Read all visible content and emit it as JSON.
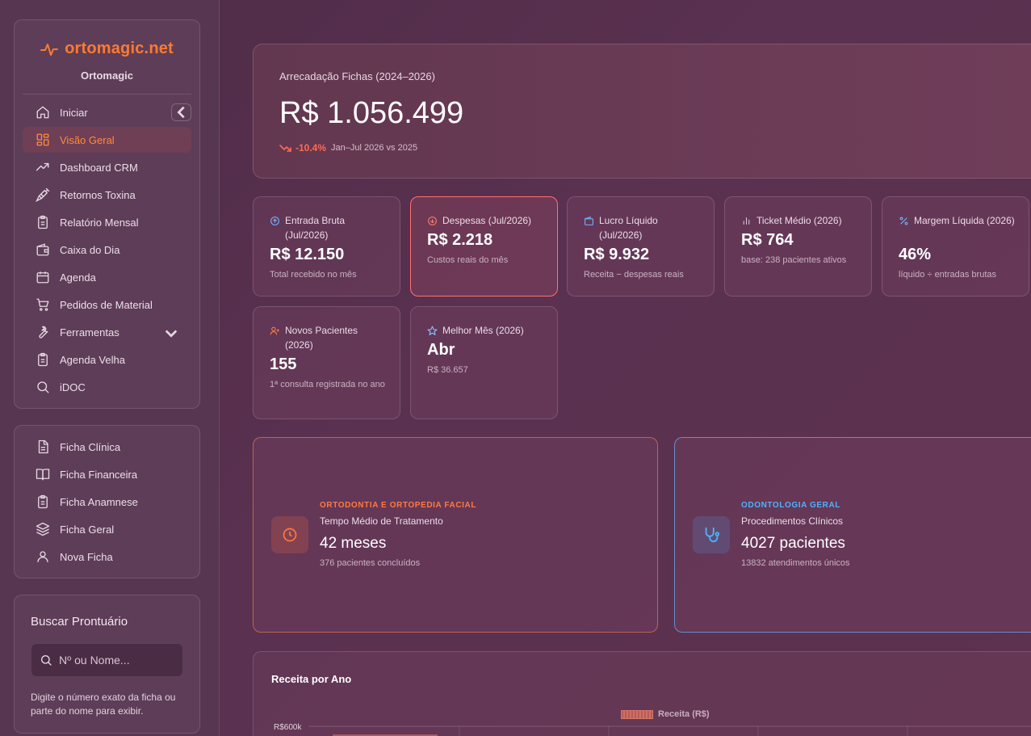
{
  "sidebar": {
    "brand_name": "ortomagic.net",
    "brand_sub": "Ortomagic",
    "items": [
      {
        "label": "Iniciar",
        "icon": "home-icon"
      },
      {
        "label": "Visão Geral",
        "icon": "grid-icon"
      },
      {
        "label": "Dashboard CRM",
        "icon": "trending-icon"
      },
      {
        "label": "Retornos Toxina",
        "icon": "syringe-icon"
      },
      {
        "label": "Relatório Mensal",
        "icon": "clipboard-icon"
      },
      {
        "label": "Caixa do Dia",
        "icon": "wallet-icon"
      },
      {
        "label": "Agenda",
        "icon": "calendar-icon"
      },
      {
        "label": "Pedidos de Material",
        "icon": "cart-icon"
      },
      {
        "label": "Ferramentas",
        "icon": "wrench-icon"
      },
      {
        "label": "Agenda Velha",
        "icon": "clipboard-icon"
      },
      {
        "label": "iDOC",
        "icon": "search-icon"
      }
    ],
    "active_item": "Visão Geral",
    "forms": [
      {
        "label": "Ficha Clínica",
        "icon": "file-text-icon"
      },
      {
        "label": "Ficha Financeira",
        "icon": "book-icon"
      },
      {
        "label": "Ficha Anamnese",
        "icon": "clipboard-icon"
      },
      {
        "label": "Ficha Geral",
        "icon": "layers-icon"
      },
      {
        "label": "Nova Ficha",
        "icon": "user-icon"
      }
    ],
    "search": {
      "title": "Buscar Prontuário",
      "placeholder": "Nº ou Nome...",
      "help": "Digite o número exato da ficha ou parte do nome para exibir."
    }
  },
  "hero": {
    "label": "Arrecadação Fichas (2024–2026)",
    "value": "R$ 1.056.499",
    "trend_pct": "-10.4%",
    "trend_note": "Jan–Jul 2026 vs 2025"
  },
  "kpis": [
    {
      "title": "Entrada Bruta (Jul/2026)",
      "value": "R$ 12.150",
      "sub": "Total recebido no mês",
      "icon": "arrow-up-circle-icon"
    },
    {
      "title": "Despesas (Jul/2026)",
      "value": "R$ 2.218",
      "sub": "Custos reais do mês",
      "icon": "arrow-down-circle-icon"
    },
    {
      "title": "Lucro Líquido (Jul/2026)",
      "value": "R$ 9.932",
      "sub": "Receita − despesas reais",
      "icon": "wallet-icon"
    },
    {
      "title": "Ticket Médio (2026)",
      "value": "R$ 764",
      "sub": "base: 238 pacientes ativos",
      "icon": "bar-chart-icon"
    },
    {
      "title": "Margem Líquida (2026)",
      "value": "46%",
      "sub": "líquido ÷ entradas brutas",
      "icon": "percent-icon"
    },
    {
      "title": "Novos Pacientes (2026)",
      "value": "155",
      "sub": "1ª consulta registrada no ano",
      "icon": "user-plus-icon"
    },
    {
      "title": "Melhor Mês (2026)",
      "value": "Abr",
      "sub": "R$ 36.657",
      "icon": "star-icon"
    }
  ],
  "specialties": [
    {
      "kicker": "ORTODONTIA E ORTOPEDIA FACIAL",
      "title": "Tempo Médio de Tratamento",
      "value": "42 meses",
      "sub": "376 pacientes concluídos",
      "icon": "clock-icon",
      "color": "#ff7a3d"
    },
    {
      "kicker": "ODONTOLOGIA GERAL",
      "title": "Procedimentos Clínicos",
      "value": "4027 pacientes",
      "sub": "13832 atendimentos únicos",
      "icon": "stethoscope-icon",
      "color": "#4db3ff"
    }
  ],
  "chart": {
    "title": "Receita por Ano",
    "legend": "Receita (R$)",
    "y_tick_top": "R$600k"
  }
}
